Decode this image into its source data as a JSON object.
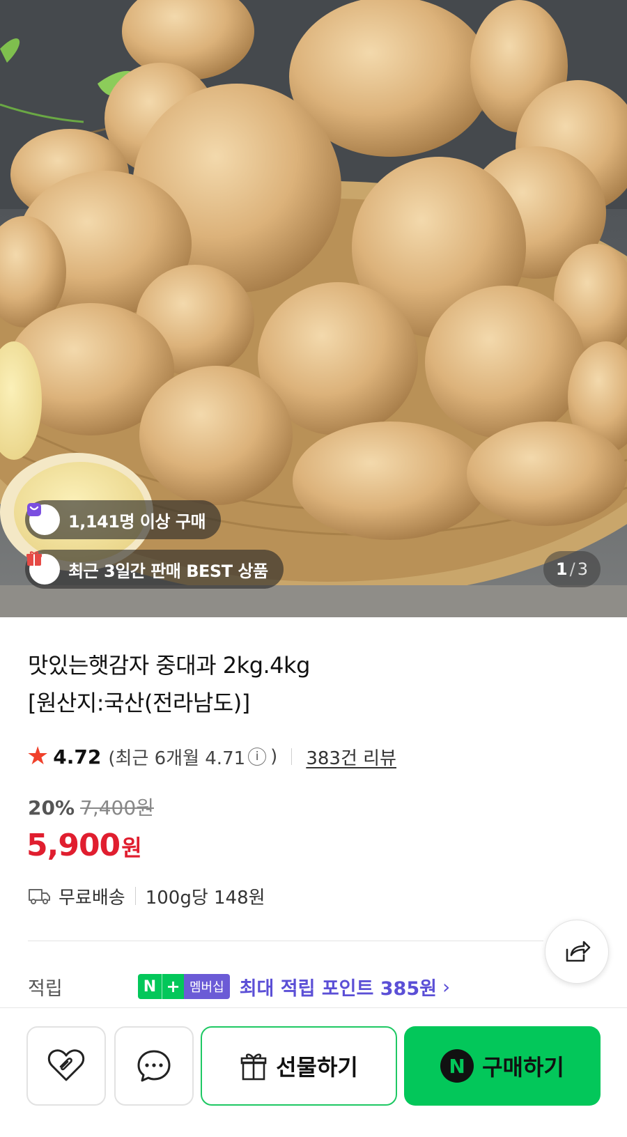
{
  "hero": {
    "badges": [
      {
        "text": "1,141명 이상 구매",
        "icon": "shopping-bag-icon",
        "color": "#7b4fe0"
      },
      {
        "text": "최근 3일간 판매 BEST 상품",
        "icon": "gift-box-icon",
        "color": "#e64a45"
      }
    ],
    "counter": {
      "current": "1",
      "separator": "/",
      "total": "3"
    }
  },
  "product": {
    "title_line1": "맛있는햇감자 중대과 2kg.4kg",
    "title_line2": "[원산지:국산(전라남도)]",
    "rating": "4.72",
    "recent_rating_prefix": "(최근 6개월 4.71",
    "recent_rating_suffix": ")",
    "review_link": "383건 리뷰",
    "discount_percent": "20%",
    "original_price": "7,400원",
    "sale_price": "5,900",
    "sale_price_unit": "원",
    "shipping": "무료배송",
    "unit_price": "100g당 148원"
  },
  "points": {
    "label": "적립",
    "badge_n": "N",
    "badge_plus": "+",
    "badge_membership": "멤버십",
    "text": "최대 적립 포인트 385원",
    "chevron": "›"
  },
  "bottom_bar": {
    "gift_label": "선물하기",
    "buy_logo": "N",
    "buy_label": "구매하기"
  },
  "colors": {
    "accent_green": "#03c75a",
    "price_red": "#e01e2f",
    "points_purple": "#5b4fd6",
    "star": "#f0412b"
  }
}
